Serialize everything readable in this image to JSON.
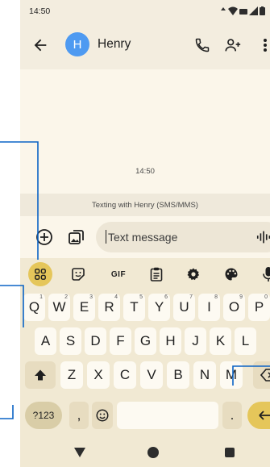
{
  "status_bar": {
    "time": "14:50"
  },
  "header": {
    "avatar_letter": "H",
    "contact_name": "Henry"
  },
  "conversation": {
    "timestamp": "14:50",
    "info": "Texting with Henry (SMS/MMS)"
  },
  "compose": {
    "placeholder": "Text message"
  },
  "keyboard": {
    "toolbar": {
      "gif_label": "GIF"
    },
    "row1": [
      {
        "key": "Q",
        "hint": "1"
      },
      {
        "key": "W",
        "hint": "2"
      },
      {
        "key": "E",
        "hint": "3"
      },
      {
        "key": "R",
        "hint": "4"
      },
      {
        "key": "T",
        "hint": "5"
      },
      {
        "key": "Y",
        "hint": "6"
      },
      {
        "key": "U",
        "hint": "7"
      },
      {
        "key": "I",
        "hint": "8"
      },
      {
        "key": "O",
        "hint": "9"
      },
      {
        "key": "P",
        "hint": "0"
      }
    ],
    "row2": [
      "A",
      "S",
      "D",
      "F",
      "G",
      "H",
      "J",
      "K",
      "L"
    ],
    "row3": [
      "Z",
      "X",
      "C",
      "V",
      "B",
      "N",
      "M"
    ],
    "symbols_label": "?123",
    "comma_label": ",",
    "period_label": "."
  },
  "colors": {
    "accent": "#e5c65a",
    "avatar": "#4e9af1",
    "annotation_line": "#0b63c5"
  },
  "icons": [
    "arrow-back-icon",
    "phone-icon",
    "add-person-icon",
    "more-vert-icon",
    "add-circle-icon",
    "gallery-icon",
    "emoji-icon",
    "voice-icon",
    "apps-grid-icon",
    "sticker-icon",
    "clipboard-icon",
    "settings-icon",
    "palette-icon",
    "mic-icon",
    "shift-icon",
    "backspace-icon",
    "enter-icon"
  ]
}
